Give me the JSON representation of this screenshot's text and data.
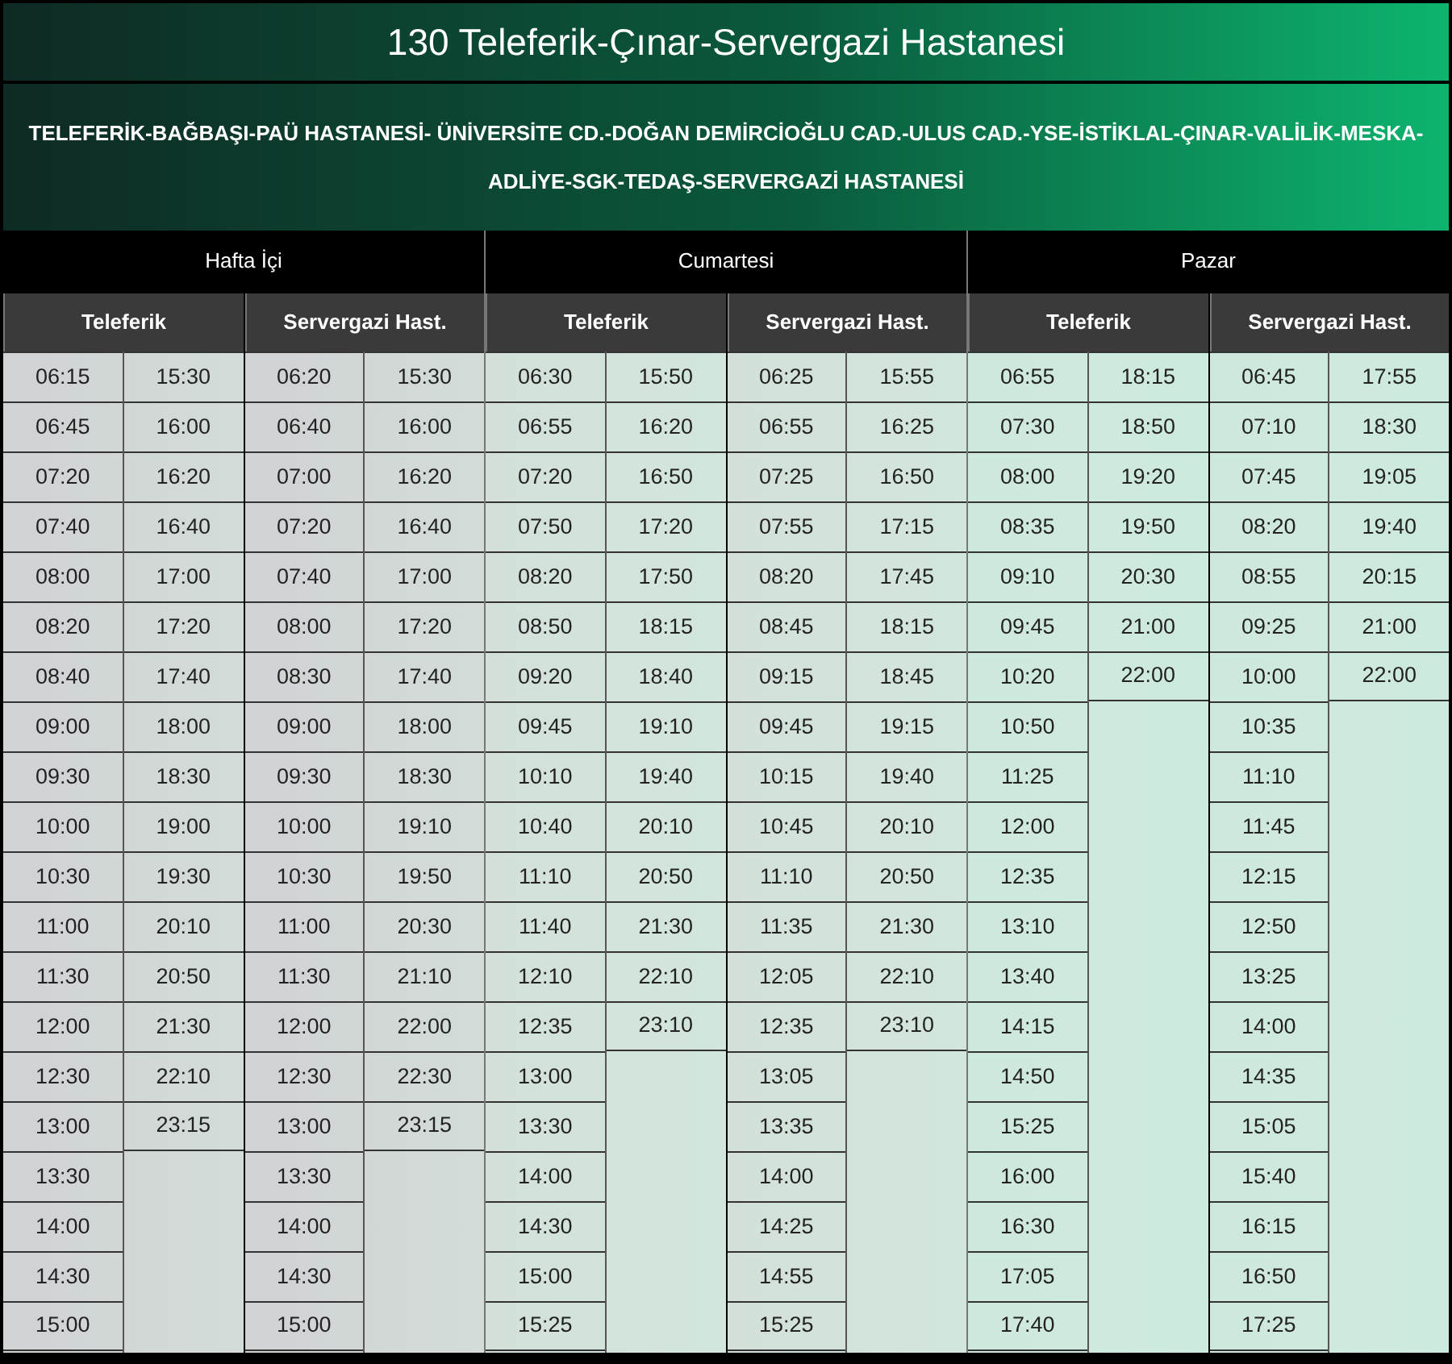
{
  "title": "130 Teleferik-Çınar-Servergazi Hastanesi",
  "route": "TELEFERİK-BAĞBAŞI-PAÜ HASTANESİ- ÜNİVERSİTE CD.-DOĞAN DEMİRCİOĞLU CAD.-ULUS CAD.-YSE-İSTİKLAL-ÇINAR-VALİLİK-MESKA-ADLİYE-SGK-TEDAŞ-SERVERGAZİ HASTANESİ",
  "days": [
    {
      "name": "Hafta İçi",
      "directions": [
        {
          "name": "Teleferik",
          "first_column": [
            "06:15",
            "06:45",
            "07:20",
            "07:40",
            "08:00",
            "08:20",
            "08:40",
            "09:00",
            "09:30",
            "10:00",
            "10:30",
            "11:00",
            "11:30",
            "12:00",
            "12:30",
            "13:00",
            "13:30",
            "14:00",
            "14:30",
            "15:00"
          ],
          "second_column": [
            "15:30",
            "16:00",
            "16:20",
            "16:40",
            "17:00",
            "17:20",
            "17:40",
            "18:00",
            "18:30",
            "19:00",
            "19:30",
            "20:10",
            "20:50",
            "21:30",
            "22:10",
            "23:15"
          ]
        },
        {
          "name": "Servergazi Hast.",
          "first_column": [
            "06:20",
            "06:40",
            "07:00",
            "07:20",
            "07:40",
            "08:00",
            "08:30",
            "09:00",
            "09:30",
            "10:00",
            "10:30",
            "11:00",
            "11:30",
            "12:00",
            "12:30",
            "13:00",
            "13:30",
            "14:00",
            "14:30",
            "15:00"
          ],
          "second_column": [
            "15:30",
            "16:00",
            "16:20",
            "16:40",
            "17:00",
            "17:20",
            "17:40",
            "18:00",
            "18:30",
            "19:10",
            "19:50",
            "20:30",
            "21:10",
            "22:00",
            "22:30",
            "23:15"
          ]
        }
      ]
    },
    {
      "name": "Cumartesi",
      "directions": [
        {
          "name": "Teleferik",
          "first_column": [
            "06:30",
            "06:55",
            "07:20",
            "07:50",
            "08:20",
            "08:50",
            "09:20",
            "09:45",
            "10:10",
            "10:40",
            "11:10",
            "11:40",
            "12:10",
            "12:35",
            "13:00",
            "13:30",
            "14:00",
            "14:30",
            "15:00",
            "15:25"
          ],
          "second_column": [
            "15:50",
            "16:20",
            "16:50",
            "17:20",
            "17:50",
            "18:15",
            "18:40",
            "19:10",
            "19:40",
            "20:10",
            "20:50",
            "21:30",
            "22:10",
            "23:10"
          ]
        },
        {
          "name": "Servergazi Hast.",
          "first_column": [
            "06:25",
            "06:55",
            "07:25",
            "07:55",
            "08:20",
            "08:45",
            "09:15",
            "09:45",
            "10:15",
            "10:45",
            "11:10",
            "11:35",
            "12:05",
            "12:35",
            "13:05",
            "13:35",
            "14:00",
            "14:25",
            "14:55",
            "15:25"
          ],
          "second_column": [
            "15:55",
            "16:25",
            "16:50",
            "17:15",
            "17:45",
            "18:15",
            "18:45",
            "19:15",
            "19:40",
            "20:10",
            "20:50",
            "21:30",
            "22:10",
            "23:10"
          ]
        }
      ]
    },
    {
      "name": "Pazar",
      "directions": [
        {
          "name": "Teleferik",
          "first_column": [
            "06:55",
            "07:30",
            "08:00",
            "08:35",
            "09:10",
            "09:45",
            "10:20",
            "10:50",
            "11:25",
            "12:00",
            "12:35",
            "13:10",
            "13:40",
            "14:15",
            "14:50",
            "15:25",
            "16:00",
            "16:30",
            "17:05",
            "17:40"
          ],
          "second_column": [
            "18:15",
            "18:50",
            "19:20",
            "19:50",
            "20:30",
            "21:00",
            "22:00"
          ]
        },
        {
          "name": "Servergazi Hast.",
          "first_column": [
            "06:45",
            "07:10",
            "07:45",
            "08:20",
            "08:55",
            "09:25",
            "10:00",
            "10:35",
            "11:10",
            "11:45",
            "12:15",
            "12:50",
            "13:25",
            "14:00",
            "14:35",
            "15:05",
            "15:40",
            "16:15",
            "16:50",
            "17:25"
          ],
          "second_column": [
            "17:55",
            "18:30",
            "19:05",
            "19:40",
            "20:15",
            "21:00",
            "22:00"
          ]
        }
      ]
    }
  ]
}
